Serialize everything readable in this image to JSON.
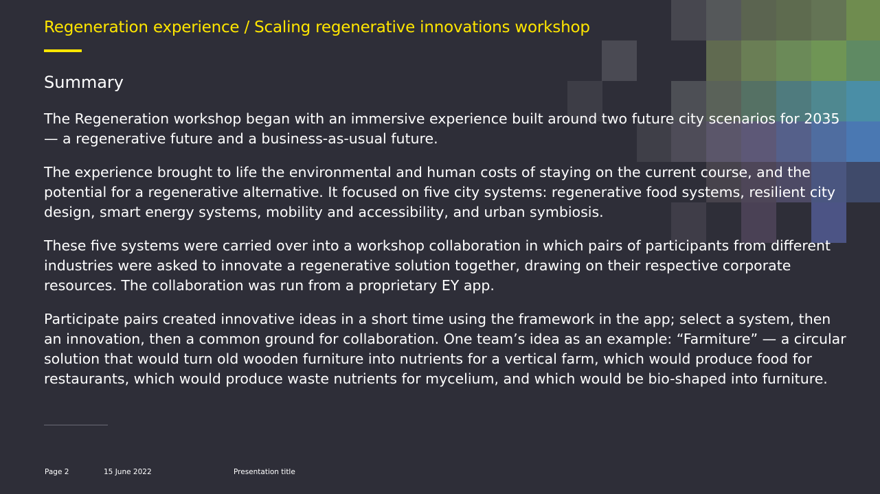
{
  "header": {
    "title": "Regeneration experience / Scaling regenerative innovations workshop"
  },
  "content": {
    "heading": "Summary",
    "paragraphs": [
      "The Regeneration workshop began with an immersive experience built around two future city scenarios for 2035 — a regenerative future and a business-as-usual future.",
      "The experience brought to life the environmental and human costs of staying on the current course, and the potential for a regenerative alternative. It focused on five city systems: regenerative food systems, resilient city design, smart energy systems, mobility and accessibility, and urban symbiosis.",
      "These five systems were carried over into a workshop collaboration in which pairs of participants from different industries were asked to innovate a regenerative solution together, drawing on their respective corporate resources. The collaboration was run from a proprietary EY app.",
      "Participate pairs created innovative ideas in a short time using the framework in the app; select a system, then an innovation, then a common ground for collaboration. One team’s idea as an example: “Farmiture” — a circular solution that would turn old wooden furniture into nutrients for a vertical farm, which would produce food for restaurants, which would produce waste nutrients for mycelium, and which would be bio-shaped into furniture."
    ]
  },
  "footer": {
    "page": "Page 2",
    "date": "15 June 2022",
    "presentation_title": "Presentation title"
  },
  "colors": {
    "background": "#2e2e38",
    "accent": "#ffe600",
    "text": "#ffffff"
  }
}
